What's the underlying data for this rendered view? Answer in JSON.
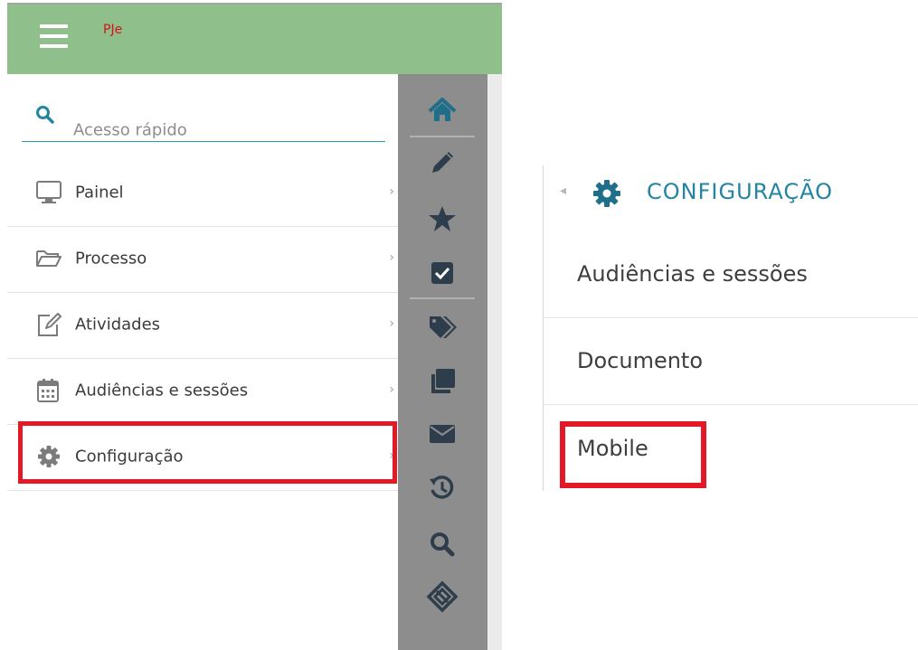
{
  "header": {
    "brand": "PJe"
  },
  "search": {
    "placeholder": "Acesso rápido"
  },
  "menu": {
    "items": [
      {
        "label": "Painel",
        "icon": "monitor-icon",
        "chevron": "›"
      },
      {
        "label": "Processo",
        "icon": "folder-open-icon",
        "chevron": "›"
      },
      {
        "label": "Atividades",
        "icon": "edit-icon",
        "chevron": "›"
      },
      {
        "label": "Audiências e sessões",
        "icon": "calendar-icon",
        "chevron": "›"
      },
      {
        "label": "Configuração",
        "icon": "gear-icon",
        "chevron": "›"
      }
    ]
  },
  "iconbar": {
    "icons": [
      "home-icon",
      "pencil-icon",
      "star-icon",
      "checkbox-icon",
      "tags-icon",
      "copy-icon",
      "envelope-icon",
      "history-icon",
      "search-icon",
      "logo-icon"
    ]
  },
  "submenu": {
    "back": "◂",
    "title": "CONFIGURAÇÃO",
    "items": [
      "Audiências e sessões",
      "Documento",
      "Mobile"
    ]
  },
  "colors": {
    "topbar": "#8fbf8b",
    "accent": "#2485a3",
    "highlight": "#e31927",
    "iconbar": "#8d8d8d",
    "icon_dark": "#2e3d4c"
  }
}
